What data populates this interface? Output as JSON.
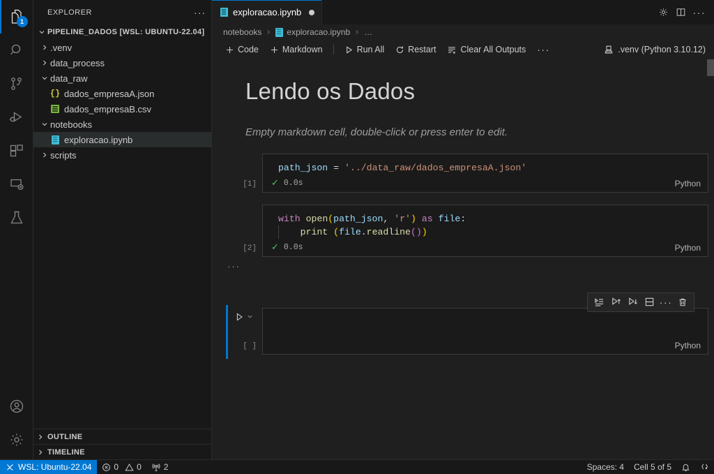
{
  "activity_bar": {
    "items": [
      {
        "name": "explorer",
        "icon": "files-icon",
        "badge": "1",
        "active": true
      },
      {
        "name": "search",
        "icon": "search-icon",
        "badge": "",
        "active": false
      },
      {
        "name": "source-control",
        "icon": "source-control-icon",
        "badge": "",
        "active": false
      },
      {
        "name": "run-and-debug",
        "icon": "run-debug-icon",
        "badge": "",
        "active": false
      },
      {
        "name": "extensions",
        "icon": "extensions-icon",
        "badge": "",
        "active": false
      },
      {
        "name": "remote-explorer",
        "icon": "remote-explorer-icon",
        "badge": "",
        "active": false
      },
      {
        "name": "testing",
        "icon": "beaker-icon",
        "badge": "",
        "active": false
      }
    ],
    "bottom": [
      {
        "name": "accounts",
        "icon": "account-icon"
      },
      {
        "name": "manage-settings",
        "icon": "gear-icon"
      }
    ]
  },
  "sidebar": {
    "title": "EXPLORER",
    "more_actions": "···",
    "root": {
      "label": "PIPELINE_DADOS [WSL: UBUNTU-22.04]",
      "expanded": true
    },
    "tree": [
      {
        "label": ".venv",
        "type": "folder",
        "expanded": false,
        "indent": 1,
        "selected": false
      },
      {
        "label": "data_process",
        "type": "folder",
        "expanded": false,
        "indent": 1,
        "selected": false
      },
      {
        "label": "data_raw",
        "type": "folder",
        "expanded": true,
        "indent": 1,
        "selected": false
      },
      {
        "label": "dados_empresaA.json",
        "type": "json",
        "expanded": null,
        "indent": 2,
        "selected": false
      },
      {
        "label": "dados_empresaB.csv",
        "type": "csv",
        "expanded": null,
        "indent": 2,
        "selected": false
      },
      {
        "label": "notebooks",
        "type": "folder",
        "expanded": true,
        "indent": 1,
        "selected": false
      },
      {
        "label": "exploracao.ipynb",
        "type": "notebook",
        "expanded": null,
        "indent": 2,
        "selected": true
      },
      {
        "label": "scripts",
        "type": "folder",
        "expanded": false,
        "indent": 1,
        "selected": false
      }
    ],
    "sections": [
      {
        "label": "OUTLINE",
        "expanded": false
      },
      {
        "label": "TIMELINE",
        "expanded": false
      }
    ]
  },
  "editor": {
    "tab": {
      "label": "exploracao.ipynb",
      "icon": "notebook-icon",
      "dirty": true
    },
    "tab_actions": [
      {
        "name": "settings-gear-icon",
        "glyph": "gear"
      },
      {
        "name": "split-editor-icon",
        "glyph": "split"
      },
      {
        "name": "editor-more-actions-icon",
        "glyph": "dots"
      }
    ],
    "breadcrumb": [
      {
        "label": "notebooks",
        "icon": ""
      },
      {
        "label": "exploracao.ipynb",
        "icon": "notebook-icon"
      },
      {
        "label": "…",
        "icon": ""
      }
    ],
    "toolbar": {
      "add_code": "Code",
      "add_markdown": "Markdown",
      "run_all": "Run All",
      "restart": "Restart",
      "clear_all_outputs": "Clear All Outputs",
      "more": "···",
      "kernel": ".venv (Python 3.10.12)"
    }
  },
  "notebook": {
    "markdown_heading": "Lendo os Dados",
    "markdown_empty_placeholder": "Empty markdown cell, double-click or press enter to edit.",
    "collapsed_indicator": "···",
    "cells": [
      {
        "exec_count": "[1]",
        "status_time": "0.0s",
        "language": "Python",
        "lines": [
          [
            {
              "t": "path_json",
              "c": "t-var"
            },
            {
              "t": " ",
              "c": "t-op"
            },
            {
              "t": "=",
              "c": "t-op"
            },
            {
              "t": " ",
              "c": "t-op"
            },
            {
              "t": "'../data_raw/dados_empresaA.json'",
              "c": "t-str"
            }
          ]
        ]
      },
      {
        "exec_count": "[2]",
        "status_time": "0.0s",
        "language": "Python",
        "lines": [
          [
            {
              "t": "with",
              "c": "t-kw"
            },
            {
              "t": " ",
              "c": "t-op"
            },
            {
              "t": "open",
              "c": "t-fn"
            },
            {
              "t": "(",
              "c": "t-p1"
            },
            {
              "t": "path_json",
              "c": "t-var"
            },
            {
              "t": ",",
              "c": "t-punc"
            },
            {
              "t": " ",
              "c": "t-op"
            },
            {
              "t": "'r'",
              "c": "t-str"
            },
            {
              "t": ")",
              "c": "t-p1"
            },
            {
              "t": " ",
              "c": "t-op"
            },
            {
              "t": "as",
              "c": "t-kw"
            },
            {
              "t": " ",
              "c": "t-op"
            },
            {
              "t": "file",
              "c": "t-var"
            },
            {
              "t": ":",
              "c": "t-punc"
            }
          ],
          [
            {
              "t": "    ",
              "c": "t-op"
            },
            {
              "t": "print",
              "c": "t-fn"
            },
            {
              "t": " ",
              "c": "t-op"
            },
            {
              "t": "(",
              "c": "t-p1"
            },
            {
              "t": "file",
              "c": "t-var"
            },
            {
              "t": ".",
              "c": "t-punc"
            },
            {
              "t": "readline",
              "c": "t-fn"
            },
            {
              "t": "(",
              "c": "t-p2"
            },
            {
              "t": ")",
              "c": "t-p2"
            },
            {
              "t": ")",
              "c": "t-p1"
            }
          ]
        ]
      }
    ],
    "active_cell": {
      "exec_count": "[ ]",
      "language": "Python",
      "code": "",
      "toolbar": [
        {
          "name": "run-by-line-icon"
        },
        {
          "name": "execute-above-cells-icon"
        },
        {
          "name": "execute-cell-and-below-icon"
        },
        {
          "name": "split-cell-icon"
        },
        {
          "name": "cell-more-actions-icon"
        },
        {
          "name": "delete-cell-icon"
        }
      ]
    }
  },
  "status_bar": {
    "remote": "WSL: Ubuntu-22.04",
    "errors": "0",
    "warnings": "0",
    "ports": "2",
    "spaces": "Spaces: 4",
    "cell_position": "Cell 5 of 5",
    "notifications_icon": "bell-icon",
    "remote_right_icon": "remote-indicator-icon"
  },
  "colors": {
    "accent": "#0078d4",
    "editor_bg": "#1f1f1f",
    "sidebar_bg": "#181818",
    "cell_bg": "#1a1a1a",
    "success_green": "#4ec94e"
  }
}
